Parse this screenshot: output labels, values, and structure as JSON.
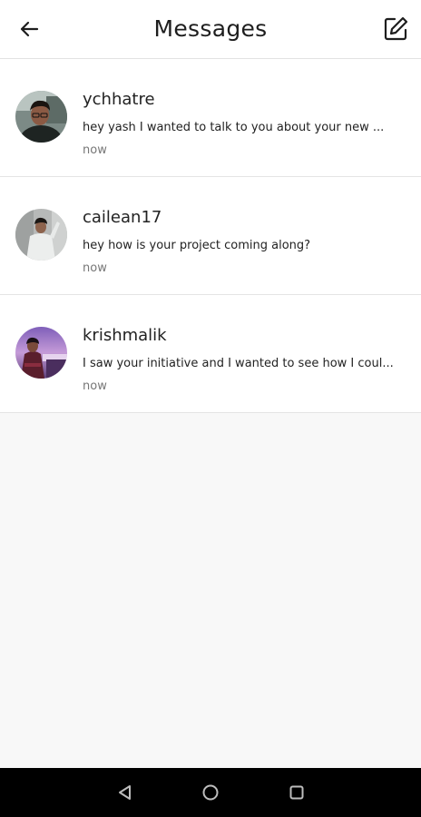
{
  "header": {
    "title": "Messages",
    "back_icon": "arrow-left-icon",
    "compose_icon": "compose-icon"
  },
  "conversations": [
    {
      "username": "ychhatre",
      "preview": "hey yash I wanted to talk to you about your new ...",
      "time": "now"
    },
    {
      "username": "cailean17",
      "preview": "hey how is your project coming along?",
      "time": "now"
    },
    {
      "username": "krishmalik",
      "preview": "I saw your initiative and I wanted to see how I coul...",
      "time": "now"
    }
  ],
  "system_nav": {
    "back_icon": "triangle-back-icon",
    "home_icon": "circle-home-icon",
    "recents_icon": "square-recents-icon"
  },
  "colors": {
    "background": "#f8f8f8",
    "card": "#ffffff",
    "text": "#1e1e1e",
    "muted": "#777777",
    "divider": "#e4e4e4",
    "navbar": "#000000"
  }
}
